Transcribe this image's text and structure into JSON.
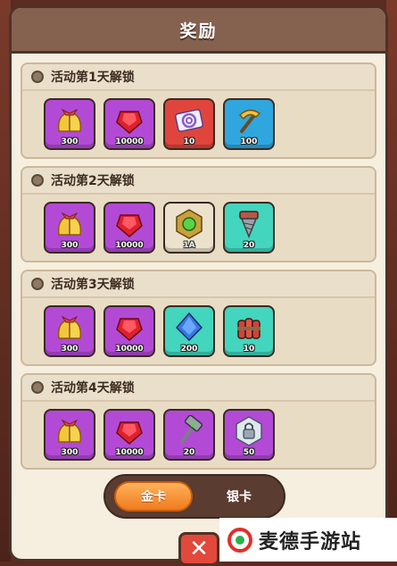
{
  "dialog": {
    "title": "奖励"
  },
  "sections": [
    {
      "title": "活动第1天解锁",
      "items": [
        {
          "icon": "golden-bells-icon",
          "bg": "purple",
          "qty": "300"
        },
        {
          "icon": "red-gem-icon",
          "bg": "purple",
          "qty": "10000"
        },
        {
          "icon": "swirl-ticket-icon",
          "bg": "red",
          "qty": "10"
        },
        {
          "icon": "gold-pickaxe-icon",
          "bg": "blue",
          "qty": "100"
        }
      ]
    },
    {
      "title": "活动第2天解锁",
      "items": [
        {
          "icon": "golden-bells-icon",
          "bg": "purple",
          "qty": "300"
        },
        {
          "icon": "red-gem-icon",
          "bg": "purple",
          "qty": "10000"
        },
        {
          "icon": "green-orb-hex-icon",
          "bg": "cream",
          "qty": "1A"
        },
        {
          "icon": "drill-icon",
          "bg": "teal",
          "qty": "20"
        }
      ]
    },
    {
      "title": "活动第3天解锁",
      "items": [
        {
          "icon": "golden-bells-icon",
          "bg": "purple",
          "qty": "300"
        },
        {
          "icon": "red-gem-icon",
          "bg": "purple",
          "qty": "10000"
        },
        {
          "icon": "blue-crystal-icon",
          "bg": "teal",
          "qty": "200"
        },
        {
          "icon": "dynamite-icon",
          "bg": "teal",
          "qty": "10"
        }
      ]
    },
    {
      "title": "活动第4天解锁",
      "items": [
        {
          "icon": "golden-bells-icon",
          "bg": "purple",
          "qty": "300"
        },
        {
          "icon": "red-gem-icon",
          "bg": "purple",
          "qty": "10000"
        },
        {
          "icon": "hammer-icon",
          "bg": "purple",
          "qty": "20"
        },
        {
          "icon": "lock-hex-icon",
          "bg": "purple",
          "qty": "50"
        }
      ]
    }
  ],
  "tabs": {
    "gold_label": "金卡",
    "silver_label": "银卡"
  },
  "close": {
    "label": "✕"
  },
  "watermark": {
    "text": "麦德手游站"
  },
  "colors": {
    "accent": "#f07b1e",
    "panel": "#f6efe0",
    "frame": "#4e3227"
  }
}
